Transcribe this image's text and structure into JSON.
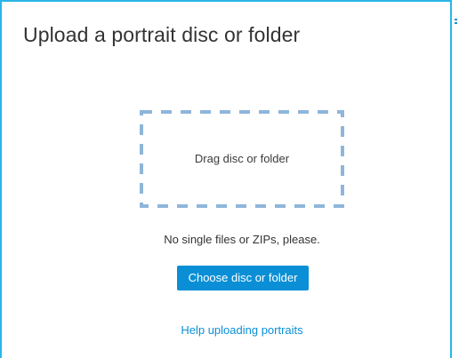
{
  "dialog": {
    "title": "Upload a portrait disc or folder"
  },
  "dropzone": {
    "label": "Drag disc or folder",
    "border_color": "#8fb6da"
  },
  "note": "No single files or ZIPs, please.",
  "choose_button": {
    "label": "Choose disc or folder",
    "color": "#0a8fd6"
  },
  "help_link": {
    "label": "Help uploading portraits",
    "color": "#0a8fd6"
  },
  "accent_color": "#29b6e8"
}
